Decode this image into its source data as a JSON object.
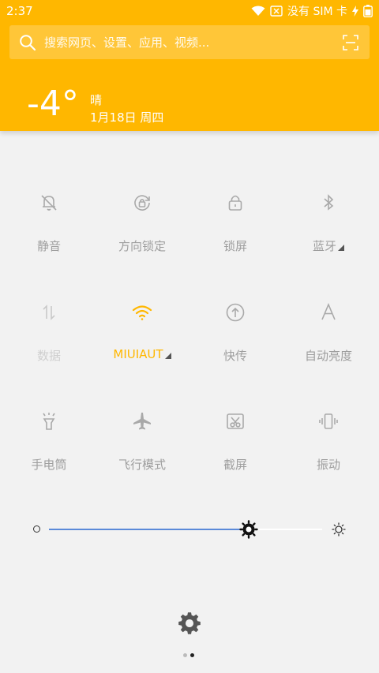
{
  "status_bar": {
    "time": "2:37",
    "no_sim_text": "没有 SIM 卡"
  },
  "search": {
    "placeholder": "搜索网页、设置、应用、视频..."
  },
  "weather": {
    "temperature": "-4°",
    "condition": "晴",
    "date": "1月18日 周四"
  },
  "tiles": [
    {
      "label": "静音",
      "icon": "bell-off-icon"
    },
    {
      "label": "方向锁定",
      "icon": "rotation-lock-icon"
    },
    {
      "label": "锁屏",
      "icon": "lock-icon"
    },
    {
      "label": "蓝牙",
      "icon": "bluetooth-icon"
    },
    {
      "label": "数据",
      "icon": "data-arrows-icon"
    },
    {
      "label": "MIUIAUT",
      "icon": "wifi-icon"
    },
    {
      "label": "快传",
      "icon": "upload-icon"
    },
    {
      "label": "自动亮度",
      "icon": "auto-brightness-icon"
    },
    {
      "label": "手电筒",
      "icon": "flashlight-icon"
    },
    {
      "label": "飞行模式",
      "icon": "airplane-icon"
    },
    {
      "label": "截屏",
      "icon": "screenshot-icon"
    },
    {
      "label": "振动",
      "icon": "vibrate-icon"
    }
  ],
  "brightness": {
    "level_percent": 73
  },
  "colors": {
    "accent": "#ffb700",
    "slider": "#5b8ad9",
    "inactive_text": "#9e9e9e"
  },
  "pager": {
    "pages": 2,
    "current": 2
  }
}
